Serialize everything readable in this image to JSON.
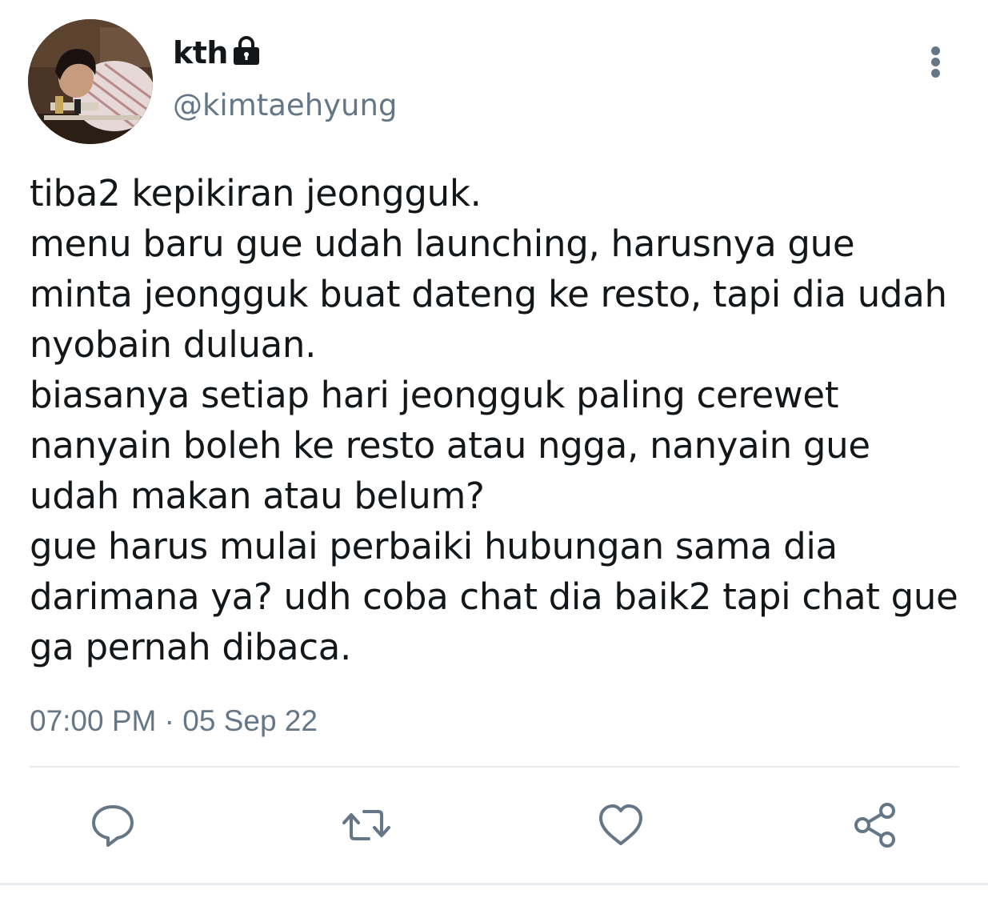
{
  "tweet": {
    "display_name": "kth",
    "handle": "@kimtaehyung",
    "text": "tiba2 kepikiran jeongguk.\nmenu baru gue udah launching, harusnya gue minta jeongguk buat dateng ke resto, tapi dia udah nyobain duluan.\nbiasanya setiap hari jeongguk paling cerewet nanyain boleh ke resto atau ngga, nanyain gue udah makan atau belum?\ngue harus mulai perbaiki hubungan sama dia darimana ya? udh coba chat dia baik2 tapi chat gue ga pernah dibaca.",
    "timestamp": "07:00 PM · 05 Sep 22",
    "protected_icon": "lock-icon",
    "menu_icon": "more-vertical-icon"
  },
  "actions": [
    {
      "icon": "reply-icon"
    },
    {
      "icon": "retweet-icon"
    },
    {
      "icon": "like-icon"
    },
    {
      "icon": "share-icon"
    }
  ],
  "colors": {
    "text_primary": "#14171a",
    "text_secondary": "#657786",
    "divider": "#e6ecf0"
  }
}
